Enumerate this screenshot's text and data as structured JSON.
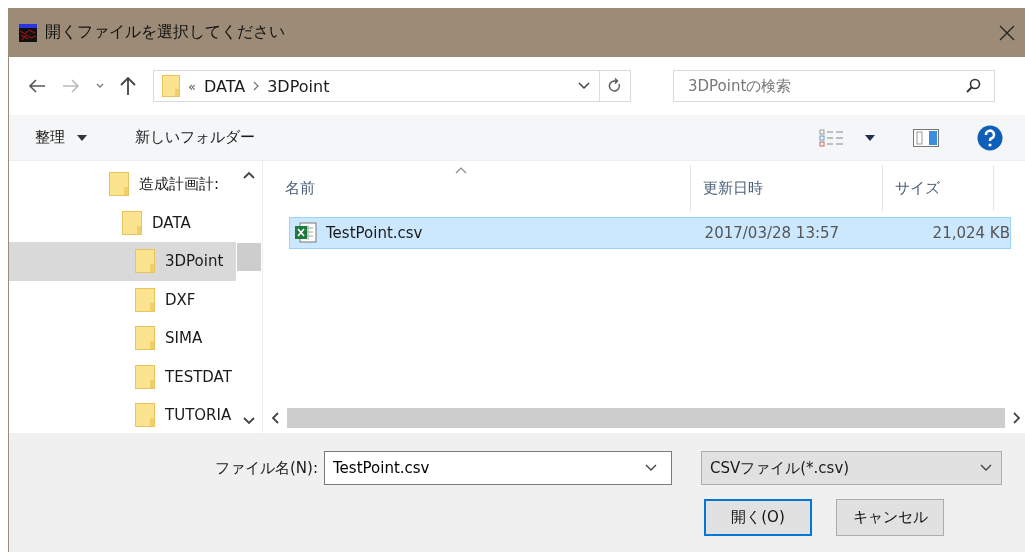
{
  "window": {
    "title": "開くファイルを選択してください"
  },
  "nav": {
    "path": [
      {
        "label": "«"
      },
      {
        "label": "DATA"
      },
      {
        "label": "3DPoint"
      }
    ],
    "search": {
      "placeholder": "3DPointの検索"
    }
  },
  "toolbar": {
    "organize": "整理",
    "new_folder": "新しいフォルダー"
  },
  "tree": [
    {
      "label": "造成計画計:",
      "selected": false,
      "children": [
        {
          "label": "DATA",
          "selected": false,
          "children": [
            {
              "label": "3DPoint",
              "selected": true
            },
            {
              "label": "DXF",
              "selected": false
            },
            {
              "label": "SIMA",
              "selected": false
            },
            {
              "label": "TESTDAT",
              "selected": false
            },
            {
              "label": "TUTORIA",
              "selected": false
            }
          ]
        }
      ]
    }
  ],
  "table": {
    "columns": [
      {
        "label": "名前",
        "sorted": true
      },
      {
        "label": "更新日時",
        "sorted": false
      },
      {
        "label": "サイズ",
        "sorted": false
      }
    ],
    "rows": [
      {
        "name": "TestPoint.csv",
        "modified": "2017/03/28 13:57",
        "size": "21,024 KB",
        "selected": true
      }
    ]
  },
  "footer": {
    "filename_label": "ファイル名(N):",
    "filename_value": "TestPoint.csv",
    "filter": "CSVファイル(*.csv)",
    "open_button": "開く(O)",
    "cancel_button": "キャンセル"
  }
}
